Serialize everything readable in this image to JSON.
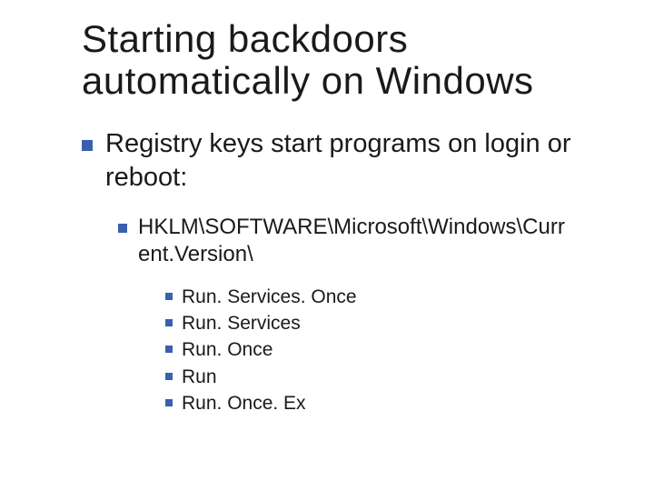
{
  "title": "Starting backdoors automatically on Windows",
  "level1": {
    "text": "Registry keys start programs on login or reboot:"
  },
  "level2": {
    "text": "HKLM\\SOFTWARE\\Microsoft\\Windows\\Curr ent.Version\\"
  },
  "level3": [
    {
      "text": "Run. Services. Once"
    },
    {
      "text": "Run. Services"
    },
    {
      "text": "Run. Once"
    },
    {
      "text": "Run"
    },
    {
      "text": "Run. Once. Ex"
    }
  ],
  "colors": {
    "bullet": "#3a5fad"
  }
}
